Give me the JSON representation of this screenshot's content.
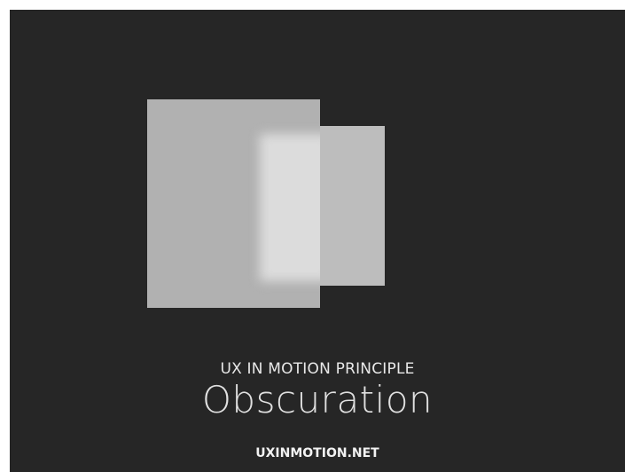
{
  "caption": {
    "eyebrow": "UX IN MOTION PRINCIPLE",
    "title": "Obscuration",
    "site": "UXINMOTION.NET"
  },
  "colors": {
    "background": "#262626",
    "front_panel": "#b1b1b1",
    "back_panel": "#bdbdbd",
    "obscured_highlight": "#dcdcdc",
    "text": "#e0e0e0"
  }
}
